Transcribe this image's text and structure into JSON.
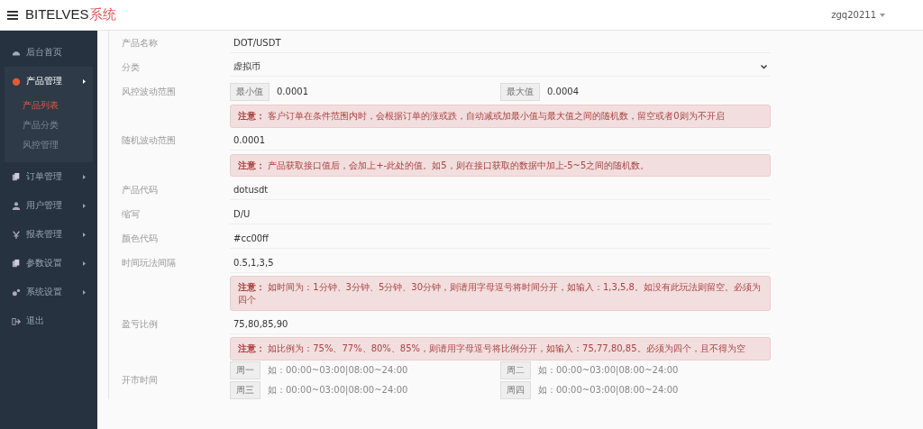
{
  "header": {
    "brand": "BITELVES",
    "brand_suffix": "系统",
    "user": "zgq20211"
  },
  "sidebar": {
    "items": [
      {
        "label": "后台首页",
        "kind": "link",
        "expanded": false
      },
      {
        "label": "产品管理",
        "kind": "group",
        "expanded": true,
        "children": [
          {
            "label": "产品列表",
            "selected": true
          },
          {
            "label": "产品分类",
            "selected": false
          },
          {
            "label": "风控管理",
            "selected": false
          }
        ]
      },
      {
        "label": "订单管理",
        "kind": "group",
        "expanded": false
      },
      {
        "label": "用户管理",
        "kind": "group",
        "expanded": false
      },
      {
        "label": "报表管理",
        "kind": "group",
        "expanded": false
      },
      {
        "label": "参数设置",
        "kind": "group",
        "expanded": false
      },
      {
        "label": "系统设置",
        "kind": "group",
        "expanded": false
      },
      {
        "label": "退出",
        "kind": "link",
        "expanded": false
      }
    ]
  },
  "form": {
    "rows": [
      {
        "kind": "text",
        "label": "产品名称",
        "value": "DOT/USDT"
      },
      {
        "kind": "select",
        "label": "分类",
        "value": "虚拟币"
      },
      {
        "kind": "range",
        "label": "风控波动范围",
        "min_label": "最小值",
        "min_value": "0.0001",
        "max_label": "最大值",
        "max_value": "0.0004"
      },
      {
        "kind": "note",
        "text": "**注意：** 客户订单在条件范围内时，会根据订单的涨或跌，自动减或加最小值与最大值之间的随机数，留空或者0则为不开启"
      },
      {
        "kind": "text",
        "label": "随机波动范围",
        "value": "0.0001"
      },
      {
        "kind": "note",
        "text": "**注意：** 产品获取接口值后，会加上+-此处的值。如5，则在接口获取的数据中加上-5~5之间的随机数。"
      },
      {
        "kind": "text",
        "label": "产品代码",
        "value": "dotusdt"
      },
      {
        "kind": "text",
        "label": "缩写",
        "value": "D/U"
      },
      {
        "kind": "text",
        "label": "颜色代码",
        "value": "#cc00ff"
      },
      {
        "kind": "text",
        "label": "时间玩法间隔",
        "value": "0.5,1,3,5"
      },
      {
        "kind": "note",
        "text": "**注意：** 如时间为：1分钟、3分钟、5分钟、30分钟，则请用字母逗号将时间分开，如输入：1,3,5,8。如没有此玩法则留空。必须为四个"
      },
      {
        "kind": "text",
        "label": "盈亏比例",
        "value": "75,80,85,90"
      },
      {
        "kind": "note",
        "text": "**注意：** 如比例为：75%、77%、80%、85%，则请用字母逗号将比例分开，如输入：75,77,80,85。必须为四个，且不得为空"
      },
      {
        "kind": "schedule",
        "label": "开市时间",
        "days": [
          {
            "day": "周一",
            "placeholder": "如：00:00~03:00|08:00~24:00"
          },
          {
            "day": "周二",
            "placeholder": "如：00:00~03:00|08:00~24:00"
          },
          {
            "day": "周三",
            "placeholder": "如：00:00~03:00|08:00~24:00"
          },
          {
            "day": "周四",
            "placeholder": "如：00:00~03:00|08:00~24:00"
          }
        ]
      }
    ]
  }
}
